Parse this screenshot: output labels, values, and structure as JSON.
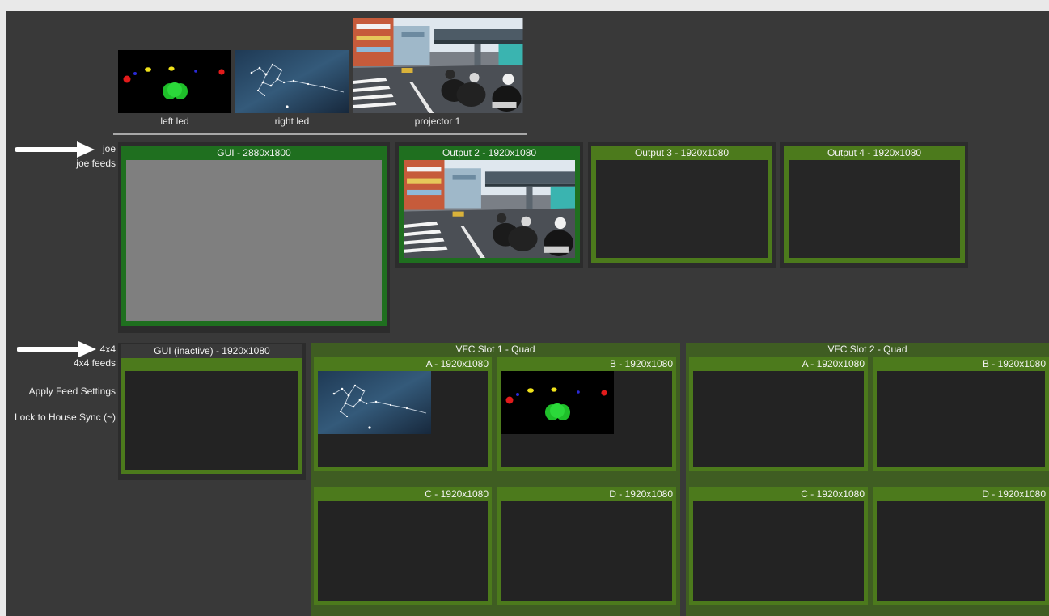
{
  "sources": [
    {
      "label": "left led",
      "image": "led-dots"
    },
    {
      "label": "right led",
      "image": "constellation"
    },
    {
      "label": "projector 1",
      "image": "street-scene"
    }
  ],
  "groups": {
    "joe": {
      "name": "joe",
      "feeds_label": "joe feeds"
    },
    "quad": {
      "name": "4x4",
      "feeds_label": "4x4 feeds",
      "apply_label": "Apply Feed Settings",
      "lock_label": "Lock to House Sync (~)"
    }
  },
  "outputs": {
    "gui": {
      "title": "GUI - 2880x1800"
    },
    "out2": {
      "title": "Output 2 - 1920x1080"
    },
    "out3": {
      "title": "Output 3 - 1920x1080"
    },
    "out4": {
      "title": "Output 4 - 1920x1080"
    },
    "gui_inactive": {
      "title": "GUI (inactive) - 1920x1080"
    }
  },
  "slots": [
    {
      "title": "VFC Slot 1 - Quad",
      "cells": [
        {
          "title": "A - 1920x1080"
        },
        {
          "title": "B - 1920x1080"
        },
        {
          "title": "C - 1920x1080"
        },
        {
          "title": "D - 1920x1080"
        }
      ]
    },
    {
      "title": "VFC Slot 2 - Quad",
      "cells": [
        {
          "title": "A - 1920x1080"
        },
        {
          "title": "B - 1920x1080"
        },
        {
          "title": "C - 1920x1080"
        },
        {
          "title": "D - 1920x1080"
        }
      ]
    }
  ],
  "colors": {
    "background": "#393939",
    "output_frame": "#4c7a1c",
    "active_frame": "#1f6f1f",
    "slot_background": "#3f5d22"
  }
}
